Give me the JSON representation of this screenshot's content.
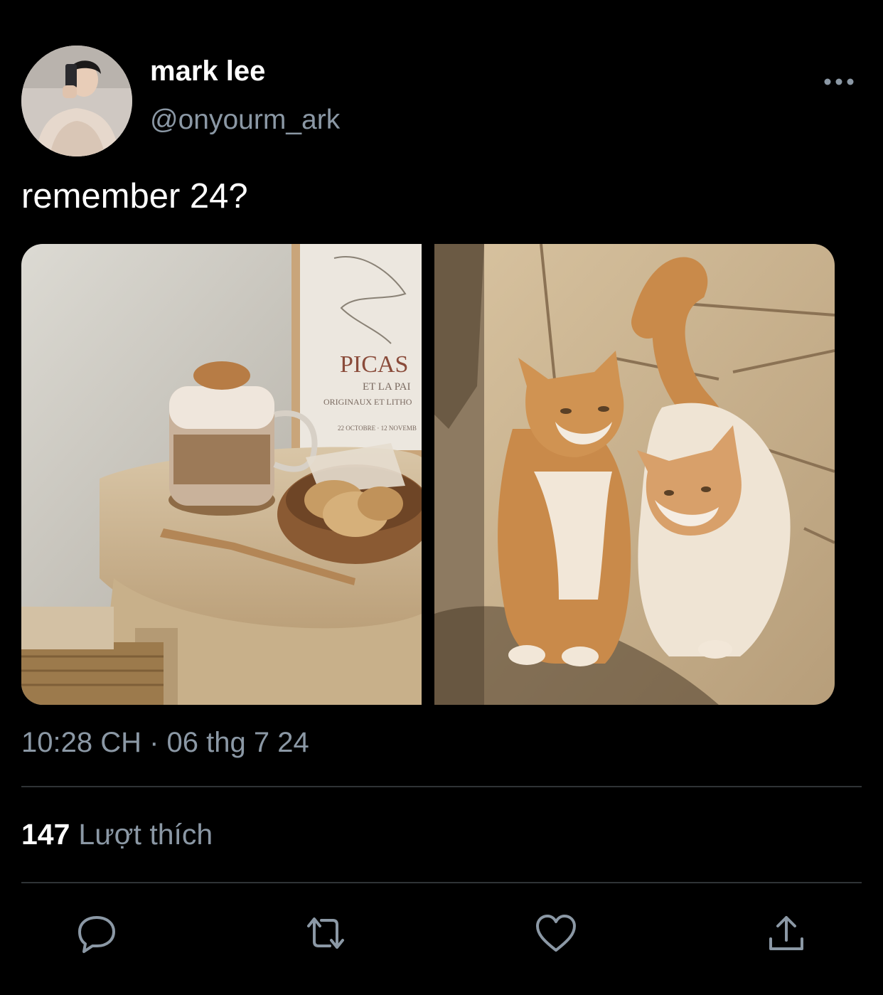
{
  "tweet": {
    "author": {
      "display_name": "mark lee",
      "handle": "@onyourm_ark"
    },
    "text": "remember 24?",
    "media": [
      {
        "description_icon": "photo-coffee-cookies"
      },
      {
        "description_icon": "photo-two-cats"
      }
    ],
    "timestamp": "10:28 CH · 06 thg 7 24",
    "likes": {
      "count": "147",
      "label": "Lượt thích"
    },
    "actions": [
      {
        "icon": "reply-icon"
      },
      {
        "icon": "retweet-icon"
      },
      {
        "icon": "heart-icon"
      },
      {
        "icon": "share-icon"
      }
    ]
  },
  "colors": {
    "background": "#000000",
    "text_primary": "#ffffff",
    "text_secondary": "#8b98a5",
    "divider": "#2f3336"
  }
}
